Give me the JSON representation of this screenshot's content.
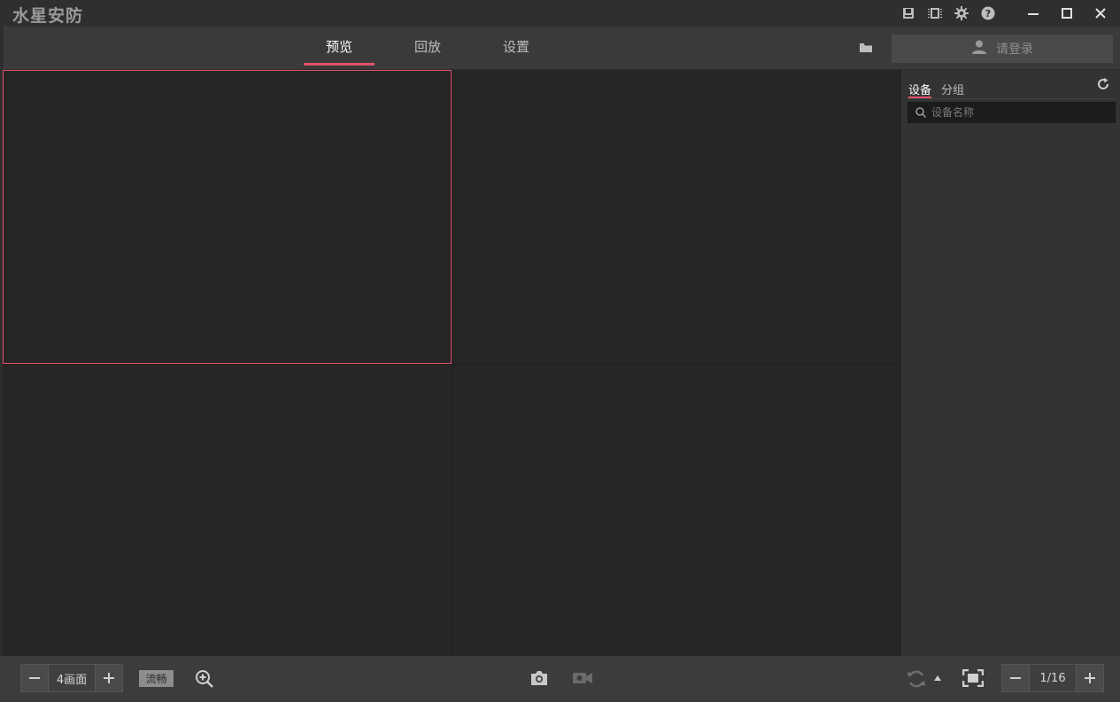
{
  "app": {
    "title": "水星安防"
  },
  "titlebar": {
    "icons": [
      "storage-icon",
      "chip-icon",
      "gear-icon",
      "help-icon"
    ],
    "window_controls": [
      "minimize-icon",
      "maximize-icon",
      "close-icon"
    ]
  },
  "nav": {
    "tabs": [
      {
        "label": "预览",
        "active": true
      },
      {
        "label": "回放",
        "active": false
      },
      {
        "label": "设置",
        "active": false
      }
    ],
    "login_label": "请登录"
  },
  "grid": {
    "pane_count": 4,
    "selected_pane": 1
  },
  "sidebar": {
    "tabs": [
      {
        "label": "设备",
        "active": true
      },
      {
        "label": "分组",
        "active": false
      }
    ],
    "search_placeholder": "设备名称"
  },
  "toolbar": {
    "layout_value": "4画面",
    "stream_label": "流畅",
    "page_indicator": "1/16"
  },
  "colors": {
    "accent": "#e4526c",
    "background": "#2e2e2e",
    "pane": "#262626"
  }
}
